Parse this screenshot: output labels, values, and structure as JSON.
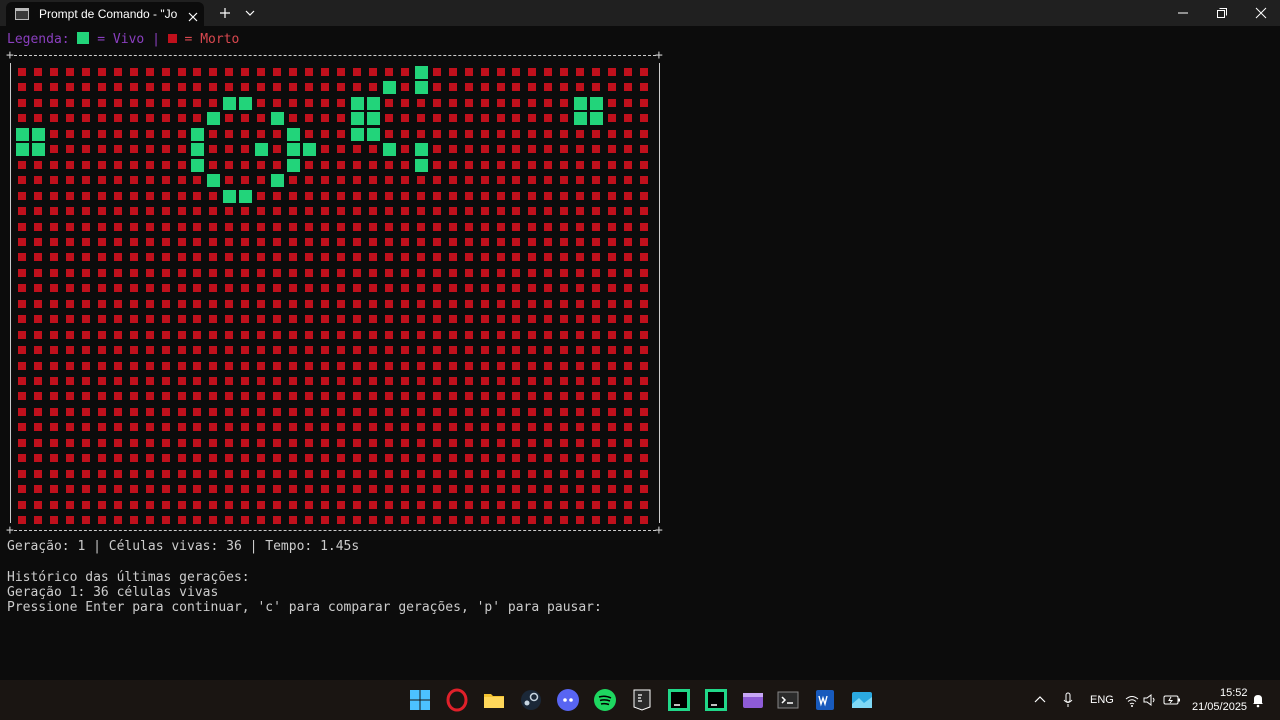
{
  "window": {
    "tab_title": "Prompt de Comando - \"Jogo_",
    "icons": [
      "terminal-icon",
      "close-icon",
      "plus-icon",
      "chevron-down-icon",
      "minimize-icon",
      "maximize-icon",
      "window-close-icon"
    ]
  },
  "legend": {
    "prefix": "Legenda: ",
    "alive_label": " = Vivo | ",
    "dead_label": " = Morto",
    "alive_color": "#22d47a",
    "dead_color": "#c0101c"
  },
  "board": {
    "rows": 30,
    "cols": 40,
    "border_top": "+------------------------------------------------------------------------------+",
    "alive_cells": [
      [
        0,
        25
      ],
      [
        1,
        23
      ],
      [
        1,
        25
      ],
      [
        2,
        13
      ],
      [
        2,
        14
      ],
      [
        2,
        21
      ],
      [
        2,
        22
      ],
      [
        2,
        35
      ],
      [
        2,
        36
      ],
      [
        3,
        12
      ],
      [
        3,
        16
      ],
      [
        3,
        21
      ],
      [
        3,
        22
      ],
      [
        3,
        35
      ],
      [
        3,
        36
      ],
      [
        4,
        0
      ],
      [
        4,
        1
      ],
      [
        4,
        11
      ],
      [
        4,
        17
      ],
      [
        4,
        21
      ],
      [
        4,
        22
      ],
      [
        5,
        0
      ],
      [
        5,
        1
      ],
      [
        5,
        11
      ],
      [
        5,
        15
      ],
      [
        5,
        17
      ],
      [
        5,
        18
      ],
      [
        5,
        23
      ],
      [
        5,
        25
      ],
      [
        6,
        11
      ],
      [
        6,
        17
      ],
      [
        6,
        25
      ],
      [
        7,
        12
      ],
      [
        7,
        16
      ],
      [
        8,
        13
      ],
      [
        8,
        14
      ]
    ]
  },
  "status": {
    "line1": "Geração: 1 | Células vivas: 36 | Tempo: 1.45s",
    "line2": "Histórico das últimas gerações:",
    "line3": "Geração 1: 36 células vivas",
    "line4": "Pressione Enter para continuar, 'c' para comparar gerações, 'p' para pausar:"
  },
  "taskbar": {
    "apps": [
      "windows-start-icon",
      "opera-icon",
      "file-explorer-icon",
      "steam-icon",
      "discord-icon",
      "spotify-icon",
      "epic-games-icon",
      "clion-icon",
      "pycharm-icon",
      "video-editor-icon",
      "terminal-icon",
      "word-icon",
      "photos-icon"
    ],
    "language": "ENG",
    "time": "15:52",
    "date": "21/05/2025"
  }
}
